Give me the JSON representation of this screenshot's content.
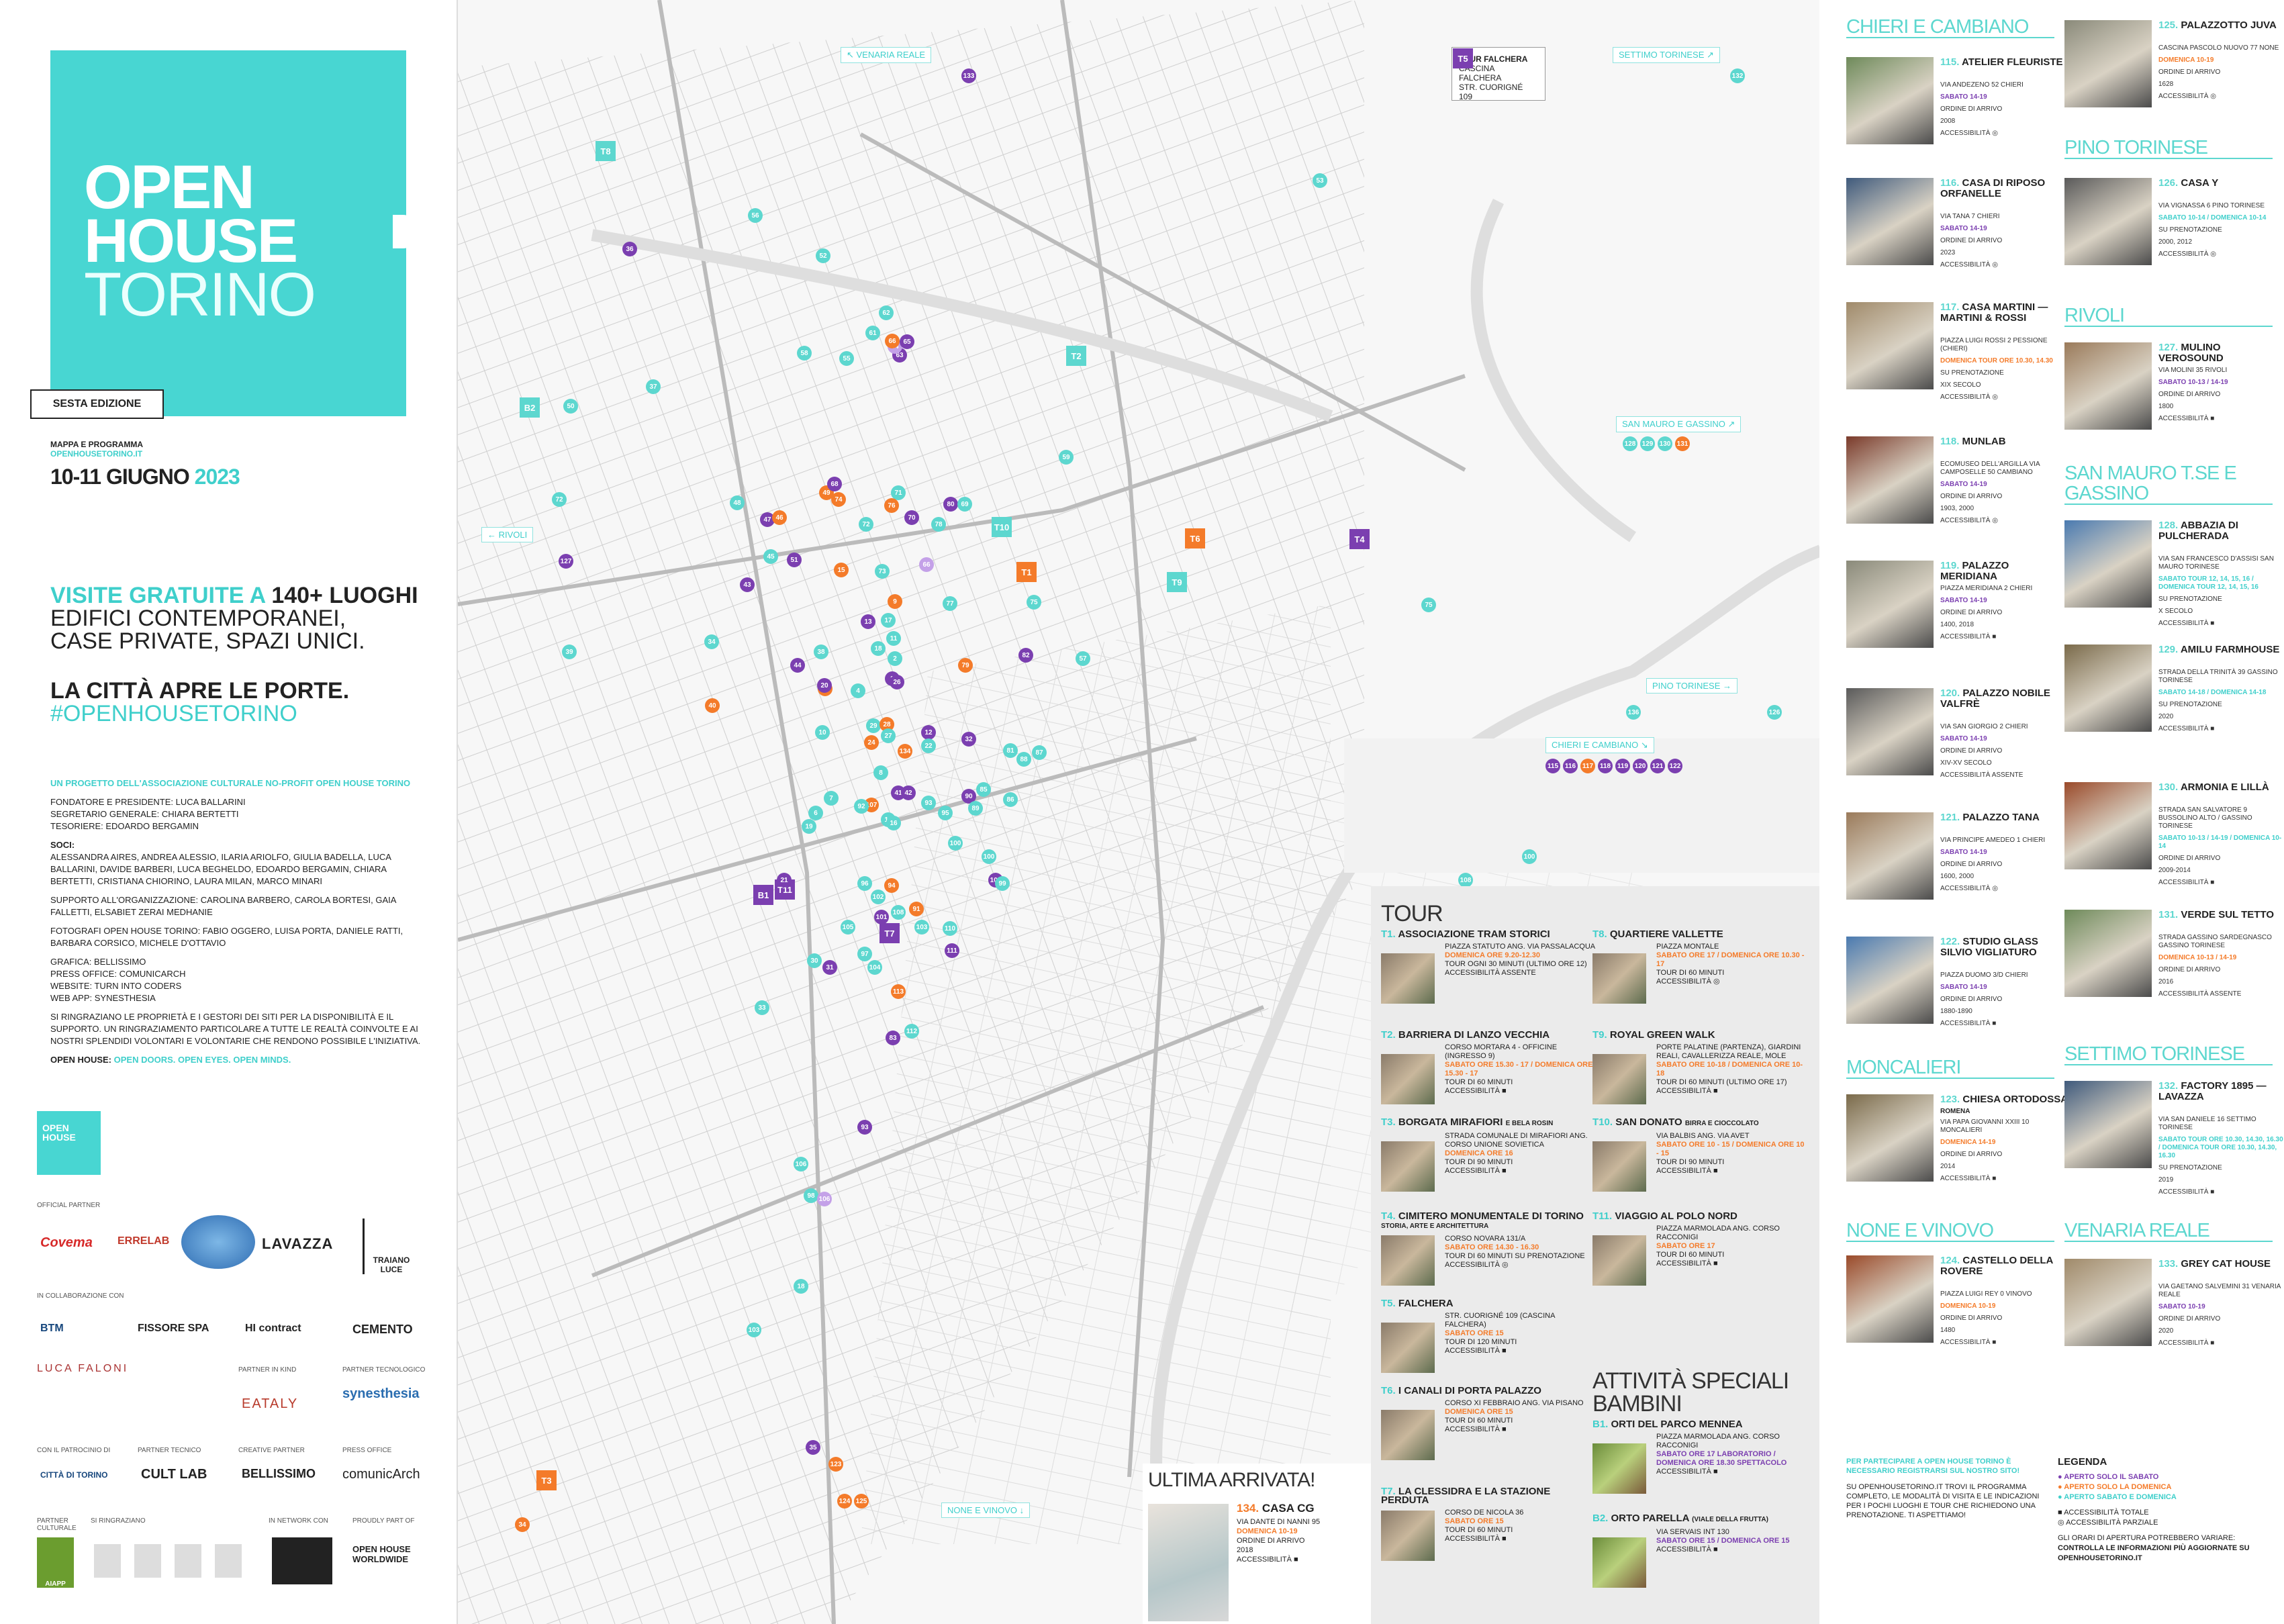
{
  "brand": {
    "logo_line1": "OPEN",
    "logo_line2": "HOUSE",
    "logo_line3": "TORINO",
    "edition": "SESTA EDIZIONE",
    "accent": "#48d6d2",
    "saturday_color": "#7b3fb0",
    "sunday_color": "#f47b2a",
    "both_color": "#5dd7cf"
  },
  "left": {
    "map_label": "MAPPA E PROGRAMMA",
    "map_sub": "OPENHOUSETORINO.IT",
    "dates_main": "10-11 GIUGNO",
    "dates_year": "2023",
    "headline1a": "VISITE GRATUITE A",
    "headline1b": "140+ LUOGHI",
    "headline2": "EDIFICI CONTEMPORANEI,",
    "headline3": "CASE PRIVATE, SPAZI UNICI.",
    "headline4": "LA CITTÀ APRE LE PORTE.",
    "hashtag": "#OPENHOUSETORINO",
    "project": "UN PROGETTO DELL'ASSOCIAZIONE CULTURALE NO-PROFIT OPEN HOUSE TORINO",
    "founders": "FONDATORE E PRESIDENTE: LUCA BALLARINI",
    "secretary": "SEGRETARIO GENERALE: CHIARA BERTETTI",
    "treasurer": "TESORIERE: EDOARDO BERGAMIN",
    "soci_h": "SOCI:",
    "soci": "ALESSANDRA AIRES, ANDREA ALESSIO, ILARIA ARIOLFO, GIULIA BADELLA, LUCA BALLARINI, DAVIDE BARBERI, LUCA BEGHELDO, EDOARDO BERGAMIN, CHIARA BERTETTI, CRISTIANA CHIORINO, LAURA MILAN, MARCO MINARI",
    "support": "SUPPORTO ALL'ORGANIZZAZIONE: CAROLINA BARBERO, CAROLA BORTESI, GAIA FALLETTI, ELSABIET ZERAI MEDHANIE",
    "photographers": "FOTOGRAFI OPEN HOUSE TORINO: FABIO OGGERO, LUISA PORTA, DANIELE RATTI, BARBARA CORSICO, MICHELE D'OTTAVIO",
    "grafica": "GRAFICA: BELLISSIMO",
    "press": "PRESS OFFICE: COMUNICARCH",
    "website": "WEBSITE: TURN INTO CODERS",
    "webapp": "WEB APP: SYNESTHESIA",
    "thanks": "SI RINGRAZIANO LE PROPRIETÀ E I GESTORI DEI SITI PER LA DISPONIBILITÀ E IL SUPPORTO. UN RINGRAZIAMENTO PARTICOLARE A TUTTE LE REALTÀ COINVOLTE E AI NOSTRI SPLENDIDI VOLONTARI E VOLONTARIE CHE RENDONO POSSIBILE L'INIZIATIVA.",
    "motto_a": "OPEN HOUSE:",
    "motto_b": "OPEN DOORS. OPEN EYES. OPEN MINDS.",
    "mini_logo1": "OPEN",
    "mini_logo2": "HOUSE",
    "official_partner": "OFFICIAL PARTNER",
    "collab": "IN COLLABORAZIONE CON",
    "partner_kind": "PARTNER IN KIND",
    "partner_tech": "PARTNER TECNOLOGICO",
    "patrocinio": "CON IL PATROCINIO DI",
    "partner_tecnico": "PARTNER TECNICO",
    "creative": "CREATIVE PARTNER",
    "press_office": "PRESS OFFICE",
    "partner_cult": "PARTNER CULTURALE",
    "ringraziamo": "SI RINGRAZIANO",
    "network": "IN NETWORK CON",
    "proudly": "PROUDLY PART OF",
    "partners": {
      "covema": "Covema",
      "errelab": "ERRELAB",
      "lavazza": "LAVAZZA",
      "traiano": "TRAIANO LUCE",
      "btm": "BTM",
      "fissore": "FISSORE SPA",
      "hi": "HI contract",
      "cemento": "CEMENTO",
      "faloni": "LUCA FALONI",
      "eataly": "EATALY",
      "synesthesia": "synesthesia",
      "citta": "CITTÀ DI TORINO",
      "cultlab": "CULT LAB",
      "bellissimo": "BELLISSIMO",
      "comunicarch": "comunicArch",
      "ohw": "OPEN HOUSE WORLDWIDE",
      "aiapp": "AIAPP"
    }
  },
  "map": {
    "zones": {
      "venaria": "↖ VENARIA REALE",
      "settimo": "SETTIMO TORINESE ↗",
      "rivoli": "← RIVOLI",
      "sanmauro": "SAN MAURO E GASSINO ↗",
      "pino": "PINO TORINESE →",
      "chieri": "CHIERI E CAMBIANO ↘",
      "none": "NONE E VINOVO ↓",
      "falchera_title": "TOUR FALCHERA",
      "falchera_sub1": "CASCINA FALCHERA",
      "falchera_sub2": "STR. CUORIGNÉ 109"
    }
  },
  "tour": {
    "title": "TOUR",
    "items": [
      {
        "code": "T1.",
        "name": "ASSOCIAZIONE TRAM STORICI",
        "addr": "PIAZZA STATUTO ANG. VIA PASSALACQUA",
        "time": "DOMENICA ORE 9.20-12.30",
        "note": "TOUR OGNI 30 MINUTI (ULTIMO ORE 12)",
        "acc": "ACCESSIBILITÀ ASSENTE"
      },
      {
        "code": "T2.",
        "name": "BARRIERA DI LANZO VECCHIA",
        "addr": "CORSO MORTARA 4 - OFFICINE (INGRESSO 9)",
        "time": "SABATO ORE 15.30 - 17 / DOMENICA ORE 15.30 - 17",
        "note": "TOUR DI 60 MINUTI",
        "acc": "ACCESSIBILITÀ ■"
      },
      {
        "code": "T3.",
        "name": "BORGATA MIRAFIORI",
        "name2": "E BELA ROSIN",
        "addr": "STRADA COMUNALE DI MIRAFIORI ANG. CORSO UNIONE SOVIETICA",
        "time": "DOMENICA ORE 16",
        "note": "TOUR DI 90 MINUTI",
        "acc": "ACCESSIBILITÀ ■"
      },
      {
        "code": "T4.",
        "name": "CIMITERO MONUMENTALE DI TORINO",
        "name2": "STORIA, ARTE E ARCHITETTURA",
        "addr": "CORSO NOVARA 131/A",
        "time": "SABATO ORE 14.30 - 16.30",
        "note": "TOUR DI 60 MINUTI SU PRENOTAZIONE",
        "acc": "ACCESSIBILITÀ ◎"
      },
      {
        "code": "T5.",
        "name": "FALCHERA",
        "addr": "STR. CUORIGNÉ 109 (CASCINA FALCHERA)",
        "time": "SABATO ORE 15",
        "note": "TOUR DI 120 MINUTI",
        "acc": "ACCESSIBILITÀ ■"
      },
      {
        "code": "T6.",
        "name": "I CANALI DI PORTA PALAZZO",
        "addr": "CORSO XI FEBBRAIO ANG. VIA PISANO",
        "time": "DOMENICA ORE 15",
        "note": "TOUR DI 60 MINUTI",
        "acc": "ACCESSIBILITÀ ■"
      },
      {
        "code": "T7.",
        "name": "LA CLESSIDRA E LA STAZIONE PERDUTA",
        "addr": "CORSO DE NICOLA 36",
        "time": "SABATO ORE 15",
        "note": "TOUR DI 60 MINUTI",
        "acc": "ACCESSIBILITÀ ■"
      },
      {
        "code": "T8.",
        "name": "QUARTIERE VALLETTE",
        "addr": "PIAZZA MONTALE",
        "time": "SABATO ORE 17 / DOMENICA ORE 10.30 - 17",
        "note": "TOUR DI 60 MINUTI",
        "acc": "ACCESSIBILITÀ ◎"
      },
      {
        "code": "T9.",
        "name": "ROYAL GREEN WALK",
        "addr": "PORTE PALATINE (PARTENZA), GIARDINI REALI, CAVALLERIZZA REALE, MOLE",
        "time": "SABATO ORE 10-18 / DOMENICA ORE 10-18",
        "note": "TOUR DI 60 MINUTI (ULTIMO ORE 17)",
        "acc": "ACCESSIBILITÀ ■"
      },
      {
        "code": "T10.",
        "name": "SAN DONATO",
        "name2": "BIRRA E CIOCCOLATO",
        "addr": "VIA BALBIS ANG. VIA AVET",
        "time": "SABATO ORE 10 - 15 / DOMENICA ORE 10 - 15",
        "note": "TOUR DI 90 MINUTI",
        "acc": "ACCESSIBILITÀ ■"
      },
      {
        "code": "T11.",
        "name": "VIAGGIO AL POLO NORD",
        "addr": "PIAZZA MARMOLADA ANG. CORSO RACCONIGI",
        "time": "SABATO ORE 17",
        "note": "TOUR DI 60 MINUTI",
        "acc": "ACCESSIBILITÀ ■"
      }
    ]
  },
  "bambini": {
    "title1": "ATTIVITÀ SPECIALI",
    "title2": "BAMBINI",
    "items": [
      {
        "code": "B1.",
        "name": "ORTI DEL PARCO MENNEA",
        "addr": "PIAZZA MARMOLADA ANG. CORSO RACCONIGI",
        "time": "SABATO ORE 17 LABORATORIO / DOMENICA ORE 18.30 SPETTACOLO",
        "acc": "ACCESSIBILITÀ ■"
      },
      {
        "code": "B2.",
        "name": "ORTO PARELLA",
        "name2": "(VIALE DELLA FRUTTA)",
        "addr": "VIA SERVAIS INT 130",
        "time": "SABATO ORE 15 / DOMENICA ORE 15",
        "acc": "ACCESSIBILITÀ ■"
      }
    ]
  },
  "ultima": {
    "title": "ULTIMA ARRIVATA!",
    "num": "134.",
    "name": "CASA CG",
    "addr": "VIA DANTE DI NANNI 95",
    "time": "DOMENICA 10-19",
    "order": "ORDINE DI ARRIVO",
    "year": "2018",
    "acc": "ACCESSIBILITÀ ■"
  },
  "regions": [
    {
      "name": "CHIERI E CAMBIANO"
    },
    {
      "name": "MONCALIERI"
    },
    {
      "name": "NONE E VINOVO"
    },
    {
      "name": "PINO TORINESE"
    },
    {
      "name": "RIVOLI"
    },
    {
      "name": "SAN MAURO T.SE E GASSINO"
    },
    {
      "name": "SETTIMO TORINESE"
    },
    {
      "name": "VENARIA REALE"
    }
  ],
  "sites_left": [
    {
      "num": "115.",
      "name": "ATELIER FLEURISTE",
      "addr": "VIA ANDEZENO 52 CHIERI",
      "time": "SABATO 14-19",
      "order": "ORDINE DI ARRIVO",
      "year": "2008",
      "acc": "ACCESSIBILITÀ ◎"
    },
    {
      "num": "116.",
      "name": "CASA DI RIPOSO ORFANELLE",
      "addr": "VIA TANA 7 CHIERI",
      "time": "SABATO 14-19",
      "order": "ORDINE DI ARRIVO",
      "year": "2023",
      "acc": "ACCESSIBILITÀ ◎"
    },
    {
      "num": "117.",
      "name": "CASA MARTINI — MARTINI & ROSSI",
      "addr": "PIAZZA LUIGI ROSSI 2 PESSIONE (CHIERI)",
      "time": "DOMENICA TOUR ORE 10.30, 14.30",
      "order": "SU PRENOTAZIONE",
      "year": "XIX SECOLO",
      "acc": "ACCESSIBILITÀ ◎"
    },
    {
      "num": "118.",
      "name": "MUNLAB",
      "addr": "ECOMUSEO DELL'ARGILLA VIA CAMPOSELLE 50 CAMBIANO",
      "time": "SABATO 14-19",
      "order": "ORDINE DI ARRIVO",
      "year": "1903, 2000",
      "acc": "ACCESSIBILITÀ ◎"
    },
    {
      "num": "119.",
      "name": "PALAZZO MERIDIANA",
      "addr": "PIAZZA MERIDIANA 2 CHIERI",
      "time": "SABATO 14-19",
      "order": "ORDINE DI ARRIVO",
      "year": "1400, 2018",
      "acc": "ACCESSIBILITÀ ■"
    },
    {
      "num": "120.",
      "name": "PALAZZO NOBILE VALFRÈ",
      "addr": "VIA SAN GIORGIO 2 CHIERI",
      "time": "SABATO 14-19",
      "order": "ORDINE DI ARRIVO",
      "year": "XIV-XV SECOLO",
      "acc": "ACCESSIBILITÀ ASSENTE"
    },
    {
      "num": "121.",
      "name": "PALAZZO TANA",
      "addr": "VIA PRINCIPE AMEDEO 1 CHIERI",
      "time": "SABATO 14-19",
      "order": "ORDINE DI ARRIVO",
      "year": "1600, 2000",
      "acc": "ACCESSIBILITÀ ◎"
    },
    {
      "num": "122.",
      "name": "STUDIO GLASS SILVIO VIGLIATURO",
      "addr": "PIAZZA DUOMO 3/D CHIERI",
      "time": "SABATO 14-19",
      "order": "ORDINE DI ARRIVO",
      "year": "1880-1890",
      "acc": "ACCESSIBILITÀ ■"
    },
    {
      "num": "123.",
      "name": "CHIESA ORTODOSSA",
      "name2": "ROMENA",
      "addr": "VIA PAPA GIOVANNI XXIII 10 MONCALIERI",
      "time": "DOMENICA 14-19",
      "order": "ORDINE DI ARRIVO",
      "year": "2014",
      "acc": "ACCESSIBILITÀ ■"
    },
    {
      "num": "124.",
      "name": "CASTELLO DELLA ROVERE",
      "addr": "PIAZZA LUIGI REY 0 VINOVO",
      "time": "DOMENICA 10-19",
      "order": "ORDINE DI ARRIVO",
      "year": "1480",
      "acc": "ACCESSIBILITÀ ■"
    }
  ],
  "sites_right": [
    {
      "num": "125.",
      "name": "PALAZZOTTO JUVA",
      "addr": "CASCINA PASCOLO NUOVO 77 NONE",
      "time": "DOMENICA 10-19",
      "order": "ORDINE DI ARRIVO",
      "year": "1628",
      "acc": "ACCESSIBILITÀ ◎"
    },
    {
      "num": "126.",
      "name": "CASA Y",
      "addr": "VIA VIGNASSA 6 PINO TORINESE",
      "time": "SABATO 10-14 / DOMENICA 10-14",
      "order": "SU PRENOTAZIONE",
      "year": "2000, 2012",
      "acc": "ACCESSIBILITÀ ◎"
    },
    {
      "num": "127.",
      "name": "MULINO VEROSOUND",
      "addr": "VIA MOLINI 35 RIVOLI",
      "time": "SABATO 10-13 / 14-19",
      "order": "ORDINE DI ARRIVO",
      "year": "1800",
      "acc": "ACCESSIBILITÀ ■"
    },
    {
      "num": "128.",
      "name": "ABBAZIA DI PULCHERADA",
      "addr": "VIA SAN FRANCESCO D'ASSISI SAN MAURO TORINESE",
      "time": "SABATO TOUR 12, 14, 15, 16 / DOMENICA TOUR 12, 14, 15, 16",
      "order": "SU PRENOTAZIONE",
      "year": "X SECOLO",
      "acc": "ACCESSIBILITÀ ■"
    },
    {
      "num": "129.",
      "name": "AMILU FARMHOUSE",
      "addr": "STRADA DELLA TRINITÀ 39 GASSINO TORINESE",
      "time": "SABATO 14-18 / DOMENICA 14-18",
      "order": "SU PRENOTAZIONE",
      "year": "2020",
      "acc": "ACCESSIBILITÀ ■"
    },
    {
      "num": "130.",
      "name": "ARMONIA E LILLÀ",
      "addr": "STRADA SAN SALVATORE 9 BUSSOLINO ALTO / GASSINO TORINESE",
      "time": "SABATO 10-13 / 14-19 / DOMENICA 10-14",
      "order": "ORDINE DI ARRIVO",
      "year": "2009-2014",
      "acc": "ACCESSIBILITÀ ■"
    },
    {
      "num": "131.",
      "name": "VERDE SUL TETTO",
      "addr": "STRADA GASSINO SARDEGNASCO GASSINO TORINESE",
      "time": "DOMENICA 10-13 / 14-19",
      "order": "ORDINE DI ARRIVO",
      "year": "2016",
      "acc": "ACCESSIBILITÀ ASSENTE"
    },
    {
      "num": "132.",
      "name": "FACTORY 1895 — LAVAZZA",
      "addr": "VIA SAN DANIELE 16 SETTIMO TORINESE",
      "time": "SABATO TOUR ORE 10.30, 14.30, 16.30 / DOMENICA TOUR ORE 10.30, 14.30, 16.30",
      "order": "SU PRENOTAZIONE",
      "year": "2019",
      "acc": "ACCESSIBILITÀ ■"
    },
    {
      "num": "133.",
      "name": "GREY CAT HOUSE",
      "addr": "VIA GAETANO SALVEMINI 31 VENARIA REALE",
      "time": "SABATO 10-19",
      "order": "ORDINE DI ARRIVO",
      "year": "2020",
      "acc": "ACCESSIBILITÀ ■"
    }
  ],
  "info": {
    "text1": "PER PARTECIPARE A OPEN HOUSE TORINO È NECESSARIO REGISTRARSI SUL NOSTRO SITO!",
    "text2": "SU OPENHOUSETORINO.IT TROVI IL PROGRAMMA COMPLETO, LE MODALITÀ DI VISITA E LE INDICAZIONI PER I POCHI LUOGHI E TOUR CHE RICHIEDONO UNA PRENOTAZIONE. TI ASPETTIAMO!",
    "legend_title": "LEGENDA",
    "leg_sat": "APERTO SOLO IL SABATO",
    "leg_sun": "APERTO SOLO LA DOMENICA",
    "leg_both": "APERTO SABATO E DOMENICA",
    "leg_acc_tot": "ACCESSIBILITÀ TOTALE",
    "leg_acc_par": "ACCESSIBILITÀ PARZIALE",
    "warn1": "GLI ORARI DI APERTURA POTREBBERO VARIARE:",
    "warn2": "CONTROLLA LE INFORMAZIONI PIÙ AGGIORNATE SU OPENHOUSETORINO.IT"
  },
  "chieri_row": [
    "115",
    "116",
    "117",
    "118",
    "119",
    "120",
    "121",
    "122"
  ],
  "sanmauro_row": [
    "128",
    "129",
    "130",
    "131"
  ]
}
